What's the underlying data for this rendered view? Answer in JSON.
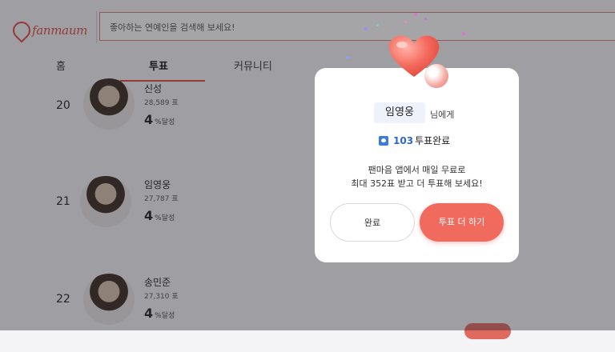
{
  "header": {
    "logo_text": "fanmaum",
    "search_text": "좋아하는 연예인을 검색해 보세요!"
  },
  "tabs": [
    {
      "label": "홈"
    },
    {
      "label": "투표"
    },
    {
      "label": "커뮤니티"
    }
  ],
  "ranking": [
    {
      "rank": "20",
      "name": "신성",
      "votes": "28,589 표",
      "pct": "4",
      "pct_suffix": "%달성"
    },
    {
      "rank": "21",
      "name": "임영웅",
      "votes": "27,787 표",
      "pct": "4",
      "pct_suffix": "%달성"
    },
    {
      "rank": "22",
      "name": "송민준",
      "votes": "27,310 표",
      "pct": "4",
      "pct_suffix": "%달성"
    }
  ],
  "modal": {
    "name": "임영웅",
    "name_suffix": "님에게",
    "vote_count": "103",
    "vote_label": "투표완료",
    "message_line1": "팬마음 앱에서 매일 무료로",
    "message_line2": "최대 352표 받고 더 투표해 보세요!",
    "done_label": "완료",
    "more_label": "투표 더 하기"
  },
  "colors": {
    "accent": "#f06a5e",
    "brand": "#e4473e",
    "badge_blue": "#3d7bd8"
  }
}
